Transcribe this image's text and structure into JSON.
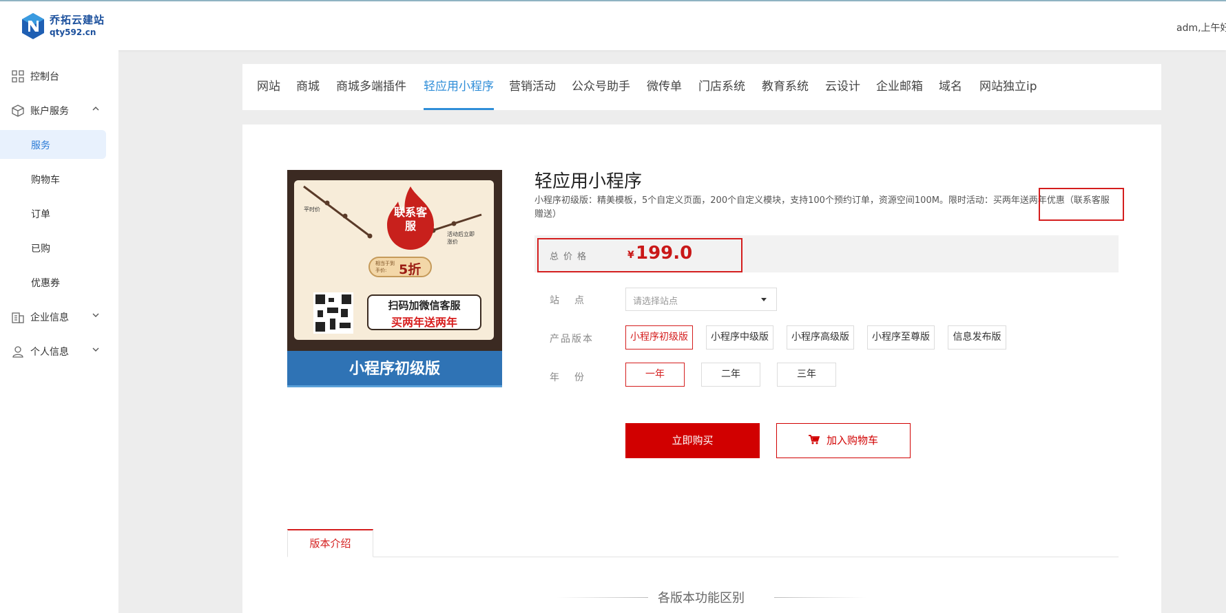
{
  "header": {
    "logo_title": "乔拓云建站",
    "logo_sub": "qty592.cn",
    "user_text": "adm,上午好"
  },
  "sidebar": {
    "items": [
      {
        "label": "控制台",
        "icon": "dashboard-icon"
      },
      {
        "label": "账户服务",
        "icon": "box-icon",
        "expanded": true
      },
      {
        "label": "服务",
        "active": true
      },
      {
        "label": "购物车"
      },
      {
        "label": "订单"
      },
      {
        "label": "已购"
      },
      {
        "label": "优惠券"
      },
      {
        "label": "企业信息",
        "icon": "building-icon"
      },
      {
        "label": "个人信息",
        "icon": "user-icon"
      }
    ]
  },
  "tabs": [
    {
      "label": "网站"
    },
    {
      "label": "商城"
    },
    {
      "label": "商城多端插件"
    },
    {
      "label": "轻应用小程序",
      "active": true
    },
    {
      "label": "营销活动"
    },
    {
      "label": "公众号助手"
    },
    {
      "label": "微传单"
    },
    {
      "label": "门店系统"
    },
    {
      "label": "教育系统"
    },
    {
      "label": "云设计"
    },
    {
      "label": "企业邮箱"
    },
    {
      "label": "域名"
    },
    {
      "label": "网站独立ip"
    }
  ],
  "product": {
    "title": "轻应用小程序",
    "description": "小程序初级版：精美模板，5个自定义页面，200个自定义模块，支持100个预约订单，资源空间100M。限时活动：买两年送两年优惠（联系客服赠送）",
    "image": {
      "flame_text": "联系客服",
      "discount_small": "相当于到手价:",
      "discount_big": "5折",
      "label_left": "平时价",
      "label_right": "活动后立即涨价",
      "bubble_line1": "扫码加微信客服",
      "bubble_line2": "买两年送两年",
      "band_text": "小程序初级版"
    },
    "price_label": "总价格",
    "currency": "¥",
    "price": "199.0",
    "site_label": "站点",
    "site_placeholder": "请选择站点",
    "version_label": "产品版本",
    "versions": [
      "小程序初级版",
      "小程序中级版",
      "小程序高级版",
      "小程序至尊版",
      "信息发布版"
    ],
    "selected_version": 0,
    "year_label": "年份",
    "years": [
      "一年",
      "二年",
      "三年"
    ],
    "selected_year": 0,
    "buy_label": "立即购买",
    "cart_label": "加入购物车",
    "intro_tab": "版本介绍",
    "diff_title": "各版本功能区别"
  },
  "colors": {
    "accent_blue": "#2f8ed8",
    "accent_red": "#d10000"
  }
}
